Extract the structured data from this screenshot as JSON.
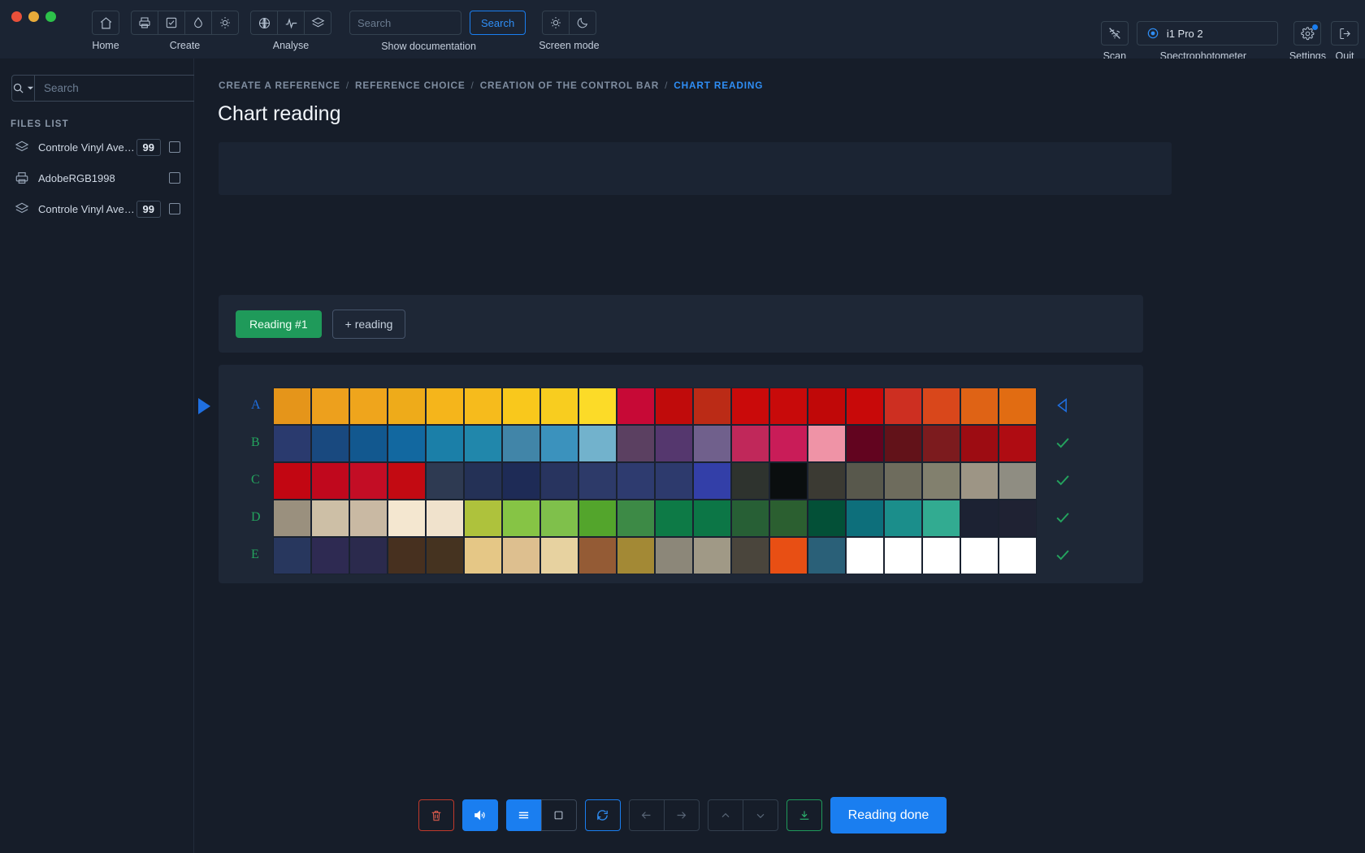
{
  "window": {
    "traffic_lights": [
      "close",
      "minimize",
      "maximize"
    ]
  },
  "toolbar": {
    "groups": [
      {
        "label": "Home",
        "icons": [
          "home-icon"
        ]
      },
      {
        "label": "Create",
        "icons": [
          "printer-icon",
          "checklist-icon",
          "droplet-icon",
          "sun-icon"
        ]
      },
      {
        "label": "Analyse",
        "icons": [
          "globe-grid-icon",
          "pulse-icon",
          "layers-icon"
        ]
      }
    ],
    "documentation": {
      "label": "Show documentation",
      "search_placeholder": "Search",
      "search_value": "",
      "search_button": "Search"
    },
    "screen_mode": {
      "label": "Screen mode",
      "icons": [
        "sun-icon",
        "moon-icon"
      ]
    },
    "scan": {
      "label": "Scan",
      "icon": "scan-off-icon"
    },
    "spectrophotometer": {
      "label": "Spectrophotometer",
      "value": "i1 Pro 2",
      "icon": "target-icon"
    },
    "settings": {
      "label": "Settings",
      "icon": "gear-icon",
      "has_notification": true
    },
    "quit": {
      "label": "Quit",
      "icon": "logout-icon"
    }
  },
  "sidebar": {
    "search": {
      "placeholder": "Search",
      "value": "",
      "icon": "search-icon",
      "dropdown_icon": "caret-down-icon"
    },
    "files_list_title": "FILES LIST",
    "files": [
      {
        "name": "Controle Vinyl Avery - ...",
        "icon": "layers-icon",
        "badge": "99",
        "checked": false
      },
      {
        "name": "AdobeRGB1998",
        "icon": "printer-icon",
        "badge": "",
        "checked": false
      },
      {
        "name": "Controle Vinyl Avery - ...",
        "icon": "layers-icon",
        "badge": "99",
        "checked": false
      }
    ]
  },
  "main": {
    "breadcrumb": [
      {
        "label": "CREATE A REFERENCE",
        "active": false
      },
      {
        "label": "REFERENCE CHOICE",
        "active": false
      },
      {
        "label": "CREATION OF THE CONTROL BAR",
        "active": false
      },
      {
        "label": "CHART READING",
        "active": true
      }
    ],
    "breadcrumb_separator": "/",
    "title": "Chart reading",
    "reading_tabs": [
      {
        "label": "Reading #1",
        "active": true
      },
      {
        "label": "+ reading",
        "active": false
      }
    ]
  },
  "chart_data": {
    "type": "table",
    "title": "Chart reading",
    "row_labels": [
      "A",
      "B",
      "C",
      "D",
      "E"
    ],
    "row_status": [
      "current",
      "done",
      "done",
      "done",
      "done"
    ],
    "row_status_icons": [
      "play-arrow-icon",
      "check-icon",
      "check-icon",
      "check-icon",
      "check-icon"
    ],
    "columns": 20,
    "patches": [
      [
        "#e5951a",
        "#eda01d",
        "#efa51c",
        "#eeab1a",
        "#f5b51b",
        "#f6bb1c",
        "#f9c81c",
        "#f8cd1f",
        "#fcdb28",
        "#c70936",
        "#c00b0b",
        "#bb2b16",
        "#ca0a0a",
        "#c80a0a",
        "#c00808",
        "#c80909",
        "#cd2f21",
        "#d9471b",
        "#df6315",
        "#e16c12"
      ],
      [
        "#2a3a6e",
        "#19497f",
        "#12588f",
        "#1268a0",
        "#1b7fa8",
        "#2187ab",
        "#4185a8",
        "#3b92bd",
        "#72b2cc",
        "#5b4061",
        "#55376e",
        "#70608c",
        "#c0285a",
        "#c91c58",
        "#ef93a6",
        "#62041f",
        "#621219",
        "#7c1b1e",
        "#9d0c12",
        "#af0c12"
      ],
      [
        "#c20612",
        "#c0081d",
        "#c30d25",
        "#c30a12",
        "#2e3a52",
        "#243156",
        "#1e2b56",
        "#28345f",
        "#2d3a69",
        "#2e3b6f",
        "#2d3a6d",
        "#333fa8",
        "#2e332e",
        "#0a0e0f",
        "#3b3a33",
        "#58584c",
        "#6e6c5d",
        "#82806e",
        "#9d9585",
        "#8f8d82"
      ],
      [
        "#9a907e",
        "#cdbfa6",
        "#c9b9a3",
        "#f4e7d0",
        "#f0e2cc",
        "#aec23c",
        "#86c445",
        "#7fc04b",
        "#53a52c",
        "#3d8a46",
        "#0d7a46",
        "#0c7646",
        "#275f35",
        "#2b5f30",
        "#035037",
        "#0d6f7b",
        "#1b8e8b",
        "#32ab91",
        "#1c2233",
        "#1f2233"
      ],
      [
        "#28375e",
        "#2e2a52",
        "#2b2a4d",
        "#47301f",
        "#453320",
        "#e5c786",
        "#ddbf8f",
        "#e7d2a0",
        "#945b35",
        "#a38935",
        "#8c8779",
        "#a09986",
        "#4a453c",
        "#e84f14",
        "#2a6078",
        "#ffffff",
        "#ffffff",
        "#ffffff",
        "#ffffff",
        "#ffffff"
      ]
    ]
  },
  "bottom_toolbar": {
    "buttons": [
      {
        "name": "delete-button",
        "icon": "trash-icon",
        "style": "red",
        "enabled": true
      },
      {
        "name": "sound-button",
        "icon": "speaker-icon",
        "style": "blue-fill",
        "enabled": true
      },
      {
        "name": "list-mode-button",
        "icon": "list-icon",
        "style": "blue-fill",
        "enabled": true
      },
      {
        "name": "patch-mode-button",
        "icon": "square-icon",
        "style": "default",
        "enabled": true
      },
      {
        "name": "refresh-button",
        "icon": "refresh-icon",
        "style": "blue-out",
        "enabled": true
      },
      {
        "name": "previous-button",
        "icon": "arrow-left-icon",
        "style": "dim",
        "enabled": false
      },
      {
        "name": "next-button",
        "icon": "arrow-right-icon",
        "style": "dim",
        "enabled": false
      },
      {
        "name": "move-up-button",
        "icon": "chevron-up-icon",
        "style": "dim",
        "enabled": false
      },
      {
        "name": "move-down-button",
        "icon": "chevron-down-icon",
        "style": "dim",
        "enabled": false
      },
      {
        "name": "download-button",
        "icon": "download-icon",
        "style": "green-out",
        "enabled": true
      }
    ],
    "primary_button": "Reading done"
  },
  "colors": {
    "accent_blue": "#1a7ef0",
    "accent_green": "#1f9a5a",
    "accent_red": "#c0392b",
    "bg": "#161d29",
    "panel": "#1e2736",
    "topbar": "#1b2433"
  }
}
